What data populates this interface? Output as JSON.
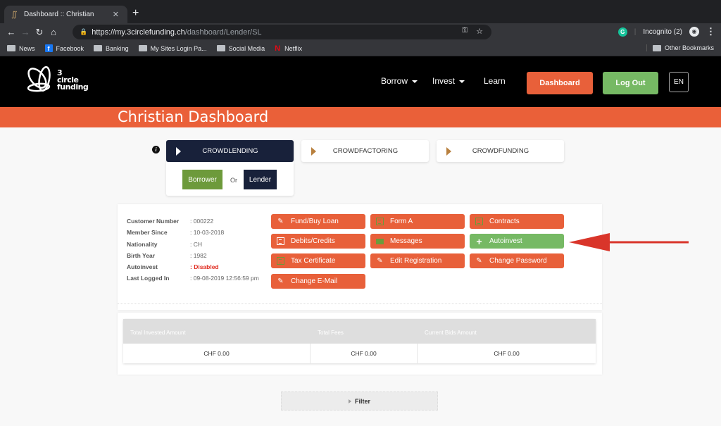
{
  "browser": {
    "tab_title": "Dashboard :: Christian",
    "url_host": "https://my.3circlefunding.ch",
    "url_path": "/dashboard/Lender/SL",
    "incognito_label": "Incognito (2)",
    "bookmarks": [
      "News",
      "Facebook",
      "Banking",
      "My Sites Login Pa...",
      "Social Media",
      "Netflix"
    ],
    "other_bookmarks": "Other Bookmarks"
  },
  "header": {
    "logo_lines": [
      "3",
      "circle",
      "funding"
    ],
    "nav": {
      "borrow": "Borrow",
      "invest": "Invest",
      "learn": "Learn"
    },
    "dashboard_button": "Dashboard",
    "logout_button": "Log Out",
    "language": "EN"
  },
  "page_title": "Christian Dashboard",
  "categories": {
    "crowdlending": "CROWDLENDING",
    "crowdfactoring": "CROWDFACTORING",
    "crowdfunding": "CROWDFUNDING"
  },
  "role": {
    "borrower": "Borrower",
    "or": "Or",
    "lender": "Lender"
  },
  "customer": {
    "rows": [
      {
        "label": "Customer Number",
        "value": ": 000222"
      },
      {
        "label": "Member Since",
        "value": ": 10-03-2018"
      },
      {
        "label": "Nationality",
        "value": ": CH"
      },
      {
        "label": "Birth Year",
        "value": ": 1982"
      },
      {
        "label": "Autoinvest",
        "value": ": Disabled"
      },
      {
        "label": "Last Logged In",
        "value": ": 09-08-2019 12:56:59 pm"
      }
    ]
  },
  "actions": {
    "fund_buy_loan": "Fund/Buy Loan",
    "form_a": "Form A",
    "contracts": "Contracts",
    "debits_credits": "Debits/Credits",
    "messages": "Messages",
    "autoinvest": "Autoinvest",
    "tax_certificate": "Tax Certificate",
    "edit_registration": "Edit Registration",
    "change_password": "Change Password",
    "change_email": "Change E-Mail"
  },
  "stats": {
    "headers": [
      "Total Invested Amount",
      "Total Fees",
      "Current Bids Amount"
    ],
    "values": [
      "CHF 0.00",
      "CHF 0.00",
      "CHF 0.00"
    ]
  },
  "filter_label": "Filter",
  "colors": {
    "brand_orange": "#ea6039",
    "green": "#76b964",
    "navy": "#18213a",
    "disabled_red": "#e02a1e"
  }
}
